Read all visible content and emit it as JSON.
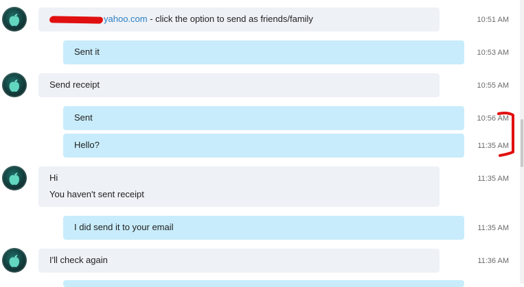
{
  "messages": [
    {
      "type": "in",
      "text_suffix": "yahoo.com",
      "text_rest": " - click the option to send as friends/family",
      "time": "10:51 AM"
    },
    {
      "type": "out",
      "text": "Sent it",
      "time": "10:53 AM"
    },
    {
      "type": "in",
      "text": "Send receipt",
      "time": "10:55 AM"
    },
    {
      "type": "out",
      "text": "Sent",
      "time": "10:56 AM"
    },
    {
      "type": "out",
      "text": "Hello?",
      "time": "11:35 AM"
    },
    {
      "type": "in",
      "line1": "Hi",
      "line2": "You haven't sent receipt",
      "time": "11:35 AM"
    },
    {
      "type": "out",
      "text": "I did send it to your email",
      "time": "11:35 AM"
    },
    {
      "type": "in",
      "text": "I'll check again",
      "time": "11:36 AM"
    }
  ],
  "colors": {
    "incoming_bubble": "#eef1f6",
    "outgoing_bubble": "#c8ecfb",
    "link": "#2a7fc2",
    "redaction": "#e01010"
  },
  "icons": {
    "avatar": "apple-avatar-icon"
  }
}
